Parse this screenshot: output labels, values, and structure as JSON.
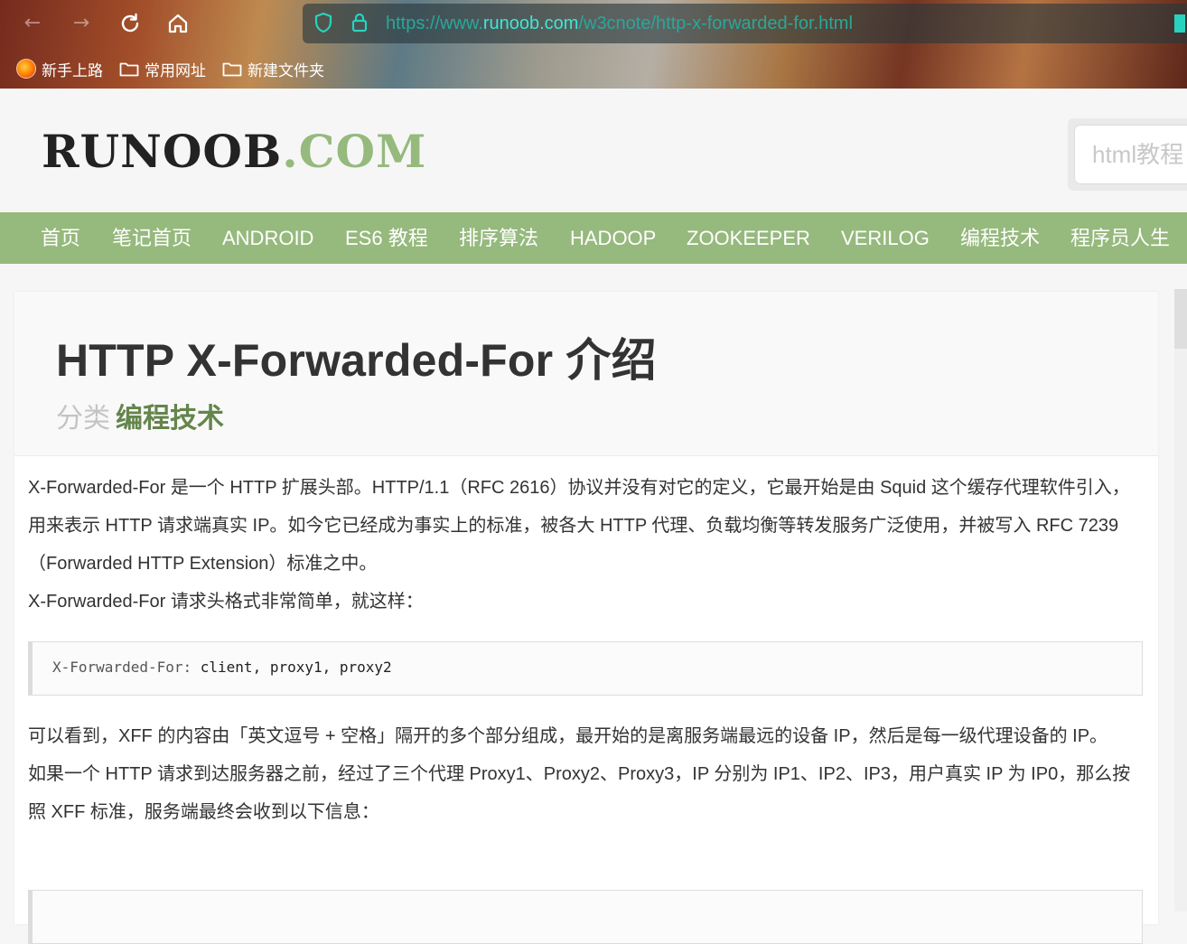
{
  "browser": {
    "url_scheme": "https://www.",
    "url_host": "runoob.com",
    "url_path": "/w3cnote/http-x-forwarded-for.html",
    "bookmarks": [
      "新手上路",
      "常用网址",
      "新建文件夹"
    ],
    "icons": [
      "back-arrow-icon",
      "forward-arrow-icon",
      "reload-icon",
      "home-icon",
      "shield-icon",
      "lock-icon",
      "folder-icon"
    ]
  },
  "site": {
    "logo_main": "RUNOOB",
    "logo_dot": ".",
    "logo_com": "COM",
    "search_placeholder": "html教程",
    "brand_color": "#96b97d"
  },
  "nav": {
    "items": [
      "首页",
      "笔记首页",
      "ANDROID",
      "ES6 教程",
      "排序算法",
      "HADOOP",
      "ZOOKEEPER",
      "VERILOG",
      "编程技术",
      "程序员人生"
    ]
  },
  "article": {
    "title": "HTTP X-Forwarded-For 介绍",
    "category_label": "分类",
    "category_value": "编程技术",
    "p1": "X-Forwarded-For 是一个 HTTP 扩展头部。HTTP/1.1（RFC 2616）协议并没有对它的定义，它最开始是由 Squid 这个缓存代理软件引入，用来表示 HTTP 请求端真实 IP。如今它已经成为事实上的标准，被各大 HTTP 代理、负载均衡等转发服务广泛使用，并被写入 RFC 7239（Forwarded HTTP Extension）标准之中。",
    "p2": "X-Forwarded-For 请求头格式非常简单，就这样：",
    "code1": {
      "key": "X-Forwarded-For:",
      "values": "client, proxy1, proxy2"
    },
    "p3": "可以看到，XFF 的内容由「英文逗号 + 空格」隔开的多个部分组成，最开始的是离服务端最远的设备 IP，然后是每一级代理设备的 IP。",
    "p4": "如果一个 HTTP 请求到达服务器之前，经过了三个代理 Proxy1、Proxy2、Proxy3，IP 分别为 IP1、IP2、IP3，用户真实 IP 为 IP0，那么按照 XFF 标准，服务端最终会收到以下信息："
  }
}
